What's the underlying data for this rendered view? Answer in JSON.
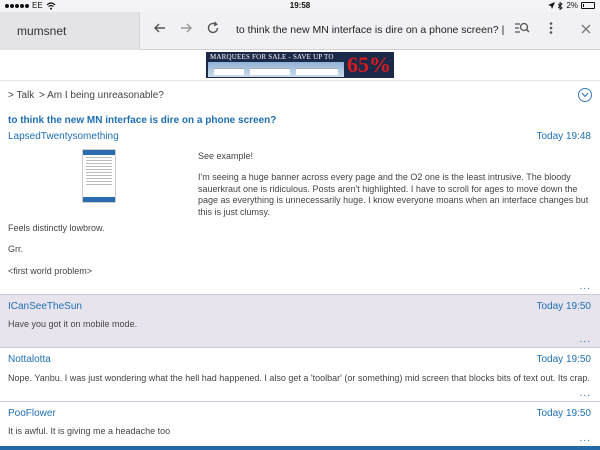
{
  "status_bar": {
    "carrier": "EE",
    "time": "19:58",
    "battery": "2%"
  },
  "browser": {
    "tab_title": "mumsnet",
    "url_text": "to think the new MN interface is dire on a phone screen? | M..."
  },
  "ad_banner": {
    "text": "MARQUEES FOR SALE - SAVE UP TO",
    "percent": "65%"
  },
  "breadcrumb": {
    "items": [
      "> Talk",
      "> Am I being unreasonable?"
    ]
  },
  "thread": {
    "title": "to think the new MN interface is dire on a phone screen?"
  },
  "posts": [
    {
      "author": "LapsedTwentysomething",
      "time": "Today 19:48",
      "paragraphs": [
        "See example!",
        "I'm seeing a huge banner across every page and the O2 one is the least intrusive. The bloody sauerkraut one is ridiculous. Posts aren't highlighted. I have to scroll for ages to move down the page as everything is unnecessarily huge. I know everyone moans when an interface changes but this is just clumsy.",
        "Feels distinctly lowbrow.",
        "Grr.",
        "<first world problem>"
      ],
      "more": "..."
    },
    {
      "author": "ICanSeeTheSun",
      "time": "Today 19:50",
      "paragraphs": [
        "Have you got it on mobile mode."
      ],
      "more": "..."
    },
    {
      "author": "Nottalotta",
      "time": "Today 19:50",
      "paragraphs": [
        "Nope. Yanbu. I was just wondering what the hell had happened. I also get a 'toolbar' (or something) mid screen that blocks bits of text out. Its crap."
      ],
      "more": "..."
    },
    {
      "author": "PooFlower",
      "time": "Today 19:50",
      "paragraphs": [
        "It is awful. It is giving me a headache too"
      ],
      "more": "..."
    }
  ],
  "colors": {
    "link_blue": "#1f6fb2",
    "highlight_bg": "#e8e4ee",
    "toolbar_bg": "#f1f1f3"
  },
  "icons": [
    "back-arrow-icon",
    "forward-arrow-icon",
    "reload-icon",
    "search-icon",
    "more-options-icon",
    "close-icon",
    "chevron-down-icon",
    "location-icon",
    "bluetooth-icon",
    "battery-icon",
    "wifi-icon"
  ]
}
